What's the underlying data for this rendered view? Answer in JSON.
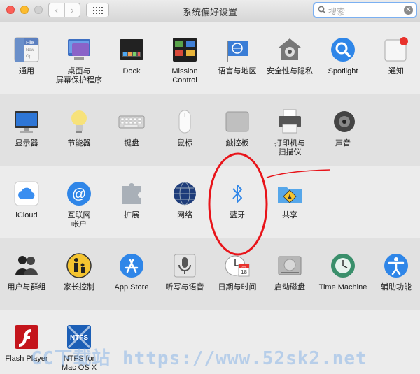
{
  "window": {
    "title": "系统偏好设置"
  },
  "search": {
    "placeholder": "搜索"
  },
  "rows": [
    [
      "通用",
      "桌面与\n屏幕保护程序",
      "Dock",
      "Mission\nControl",
      "语言与地区",
      "安全性与隐私",
      "Spotlight",
      "通知"
    ],
    [
      "显示器",
      "节能器",
      "键盘",
      "鼠标",
      "触控板",
      "打印机与\n扫描仪",
      "声音"
    ],
    [
      "iCloud",
      "互联网\n帐户",
      "扩展",
      "网络",
      "蓝牙",
      "共享"
    ],
    [
      "用户与群组",
      "家长控制",
      "App Store",
      "听写与语音",
      "日期与时间",
      "启动磁盘",
      "Time Machine",
      "辅助功能"
    ],
    [
      "Flash Player",
      "NTFS for\nMac OS X"
    ]
  ],
  "icons": {
    "general": {
      "text": "File\nNew\nOp"
    },
    "calendar": {
      "month": "JUL",
      "day": "18"
    },
    "ntfs": {
      "text": "NTFS"
    }
  },
  "watermark": "CC下载站 https://www.52sk2.net",
  "colors": {
    "accent": "#2f86e8",
    "annotation": "#e8141a"
  }
}
